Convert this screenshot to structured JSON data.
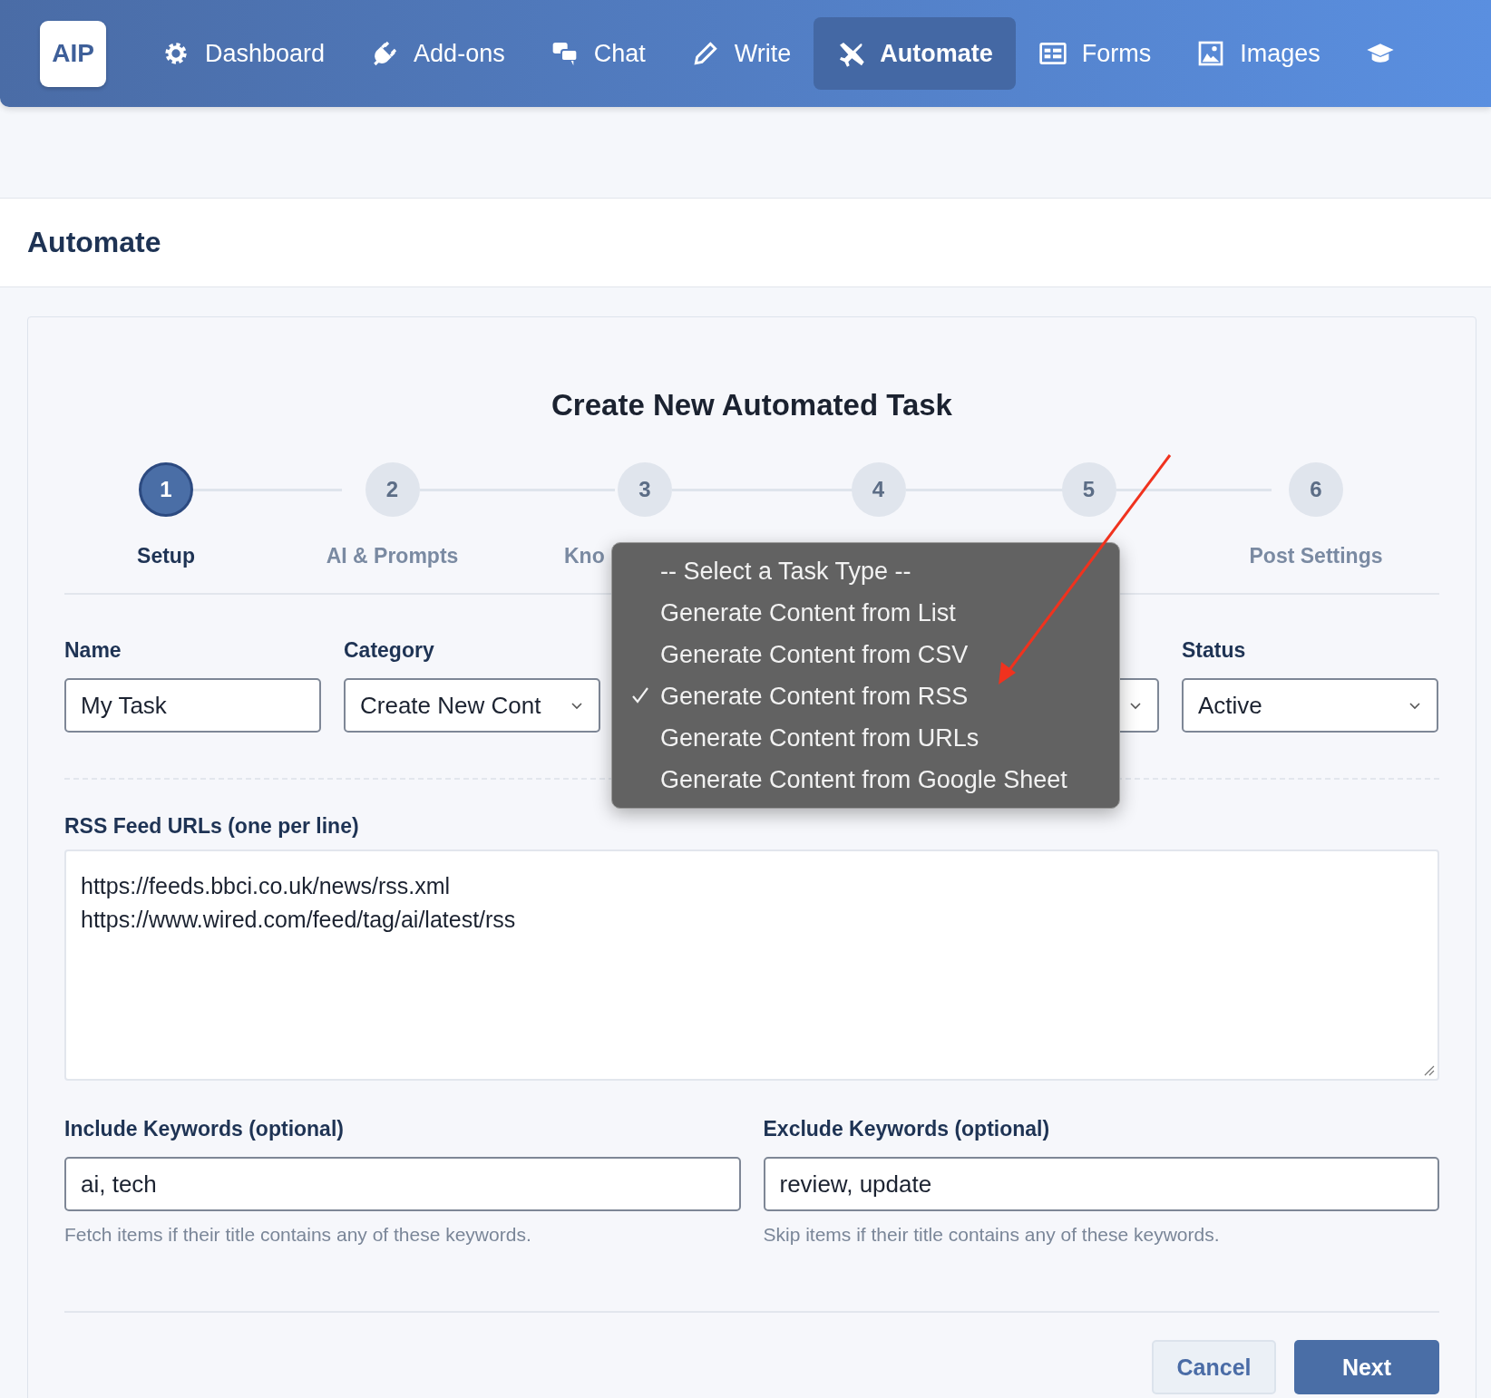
{
  "nav": {
    "logo": "AIP",
    "items": [
      {
        "label": "Dashboard",
        "selected": false
      },
      {
        "label": "Add-ons",
        "selected": false
      },
      {
        "label": "Chat",
        "selected": false
      },
      {
        "label": "Write",
        "selected": false
      },
      {
        "label": "Automate",
        "selected": true
      },
      {
        "label": "Forms",
        "selected": false
      },
      {
        "label": "Images",
        "selected": false
      },
      {
        "selected": false
      }
    ]
  },
  "page_title": "Automate",
  "card": {
    "title": "Create New Automated Task",
    "steps": [
      {
        "number": "1",
        "label": "Setup",
        "selected": true
      },
      {
        "number": "2",
        "label": "AI & Prompts",
        "selected": false
      },
      {
        "number": "3",
        "label": "Kno",
        "selected": false
      },
      {
        "number": "4",
        "selected": false
      },
      {
        "number": "5",
        "selected": false
      },
      {
        "number": "6",
        "label": "Post Settings",
        "selected": false
      }
    ],
    "fields": [
      {
        "kind": "input",
        "label": "Name",
        "value": "My Task"
      },
      {
        "kind": "select",
        "label": "Category",
        "value": "Create New Cont"
      },
      {
        "kind": "select"
      },
      {
        "kind": "select",
        "label": "Status",
        "value": "Active"
      }
    ],
    "task_type_menu": [
      {
        "label": "-- Select a Task Type --",
        "selected": false
      },
      {
        "label": "Generate Content from List",
        "selected": false
      },
      {
        "label": "Generate Content from CSV",
        "selected": false
      },
      {
        "label": "Generate Content from RSS",
        "selected": true
      },
      {
        "label": "Generate Content from URLs",
        "selected": false
      },
      {
        "label": "Generate Content from Google Sheet",
        "selected": false
      }
    ],
    "rss": {
      "label": "RSS Feed URLs (one per line)",
      "value": "https://feeds.bbci.co.uk/news/rss.xml\nhttps://www.wired.com/feed/tag/ai/latest/rss"
    },
    "keywords": [
      {
        "label": "Include Keywords (optional)",
        "value": "ai, tech",
        "hint": "Fetch items if their title contains any of these keywords."
      },
      {
        "label": "Exclude Keywords (optional)",
        "value": "review, update",
        "hint": "Skip items if their title contains any of these keywords."
      }
    ],
    "buttons": [
      {
        "kind": "secondary",
        "label": "Cancel"
      },
      {
        "kind": "primary",
        "label": "Next"
      }
    ]
  }
}
